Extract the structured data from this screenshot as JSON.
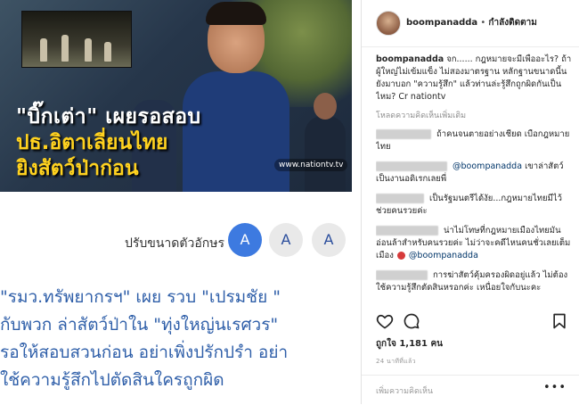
{
  "article": {
    "image": {
      "headline_line1": "\"บิ๊กเต่า\" เผยรอสอบ",
      "headline_line2": "ปธ.อิตาเลี่ยนไทย",
      "headline_line3": "ยิงสัตว์ป่าก่อน",
      "logo_text": "www.nationtv.tv"
    },
    "font_size": {
      "label": "ปรับขนาดตัวอักษร",
      "options": [
        "A",
        "A",
        "A"
      ],
      "selected_index": 0
    },
    "body_lines": [
      "\"รมว.ทรัพยากรฯ\" เผย รวบ \"เปรมชัย \"",
      "กับพวก ล่าสัตว์ป่าใน \"ทุ่งใหญ่นเรศวร\"",
      "รอให้สอบสวนก่อน อย่าเพิ่งปรักปรำ อย่า",
      "ใช้ความรู้สึกไปตัดสินใครถูกผิด"
    ]
  },
  "instagram": {
    "username": "boompanadda",
    "dot": " • ",
    "follow_status": "กำลังติดตาม",
    "caption": {
      "user": "boompanadda",
      "text": "จก...... กฎหมายจะมีเพื่ออะไร? ถ้าผู้ใหญ่ไม่เข้มแข็ง ไม่สองมาตรฐาน หลักฐานขนาดนี้น ยังมาบอก \"ความรู้สึก\" แล้วท่านล่ะรู้สึกถูกผิดกันเป็นไหม? Cr nationtv"
    },
    "load_more": "โหลดความคิดเห็นเพิ่มเติม",
    "comments": [
      {
        "text": "ถ้าคนจนตายอย่างเชียด เบือกฎหมายไทย",
        "mention": ""
      },
      {
        "text": "เขาล่าสัตว์เป็นงานอดิเรกเลยพี่",
        "mention": "@boompanadda"
      },
      {
        "text": "เป็นรัฐมนตรีได้งัย...กฎหมายไทยมีไว้ช่วยคนรวยค่ะ",
        "mention": ""
      },
      {
        "text": "น่าไม่โทษที่กฎหมายเมืองไทยมันอ่อนล้าสำหรับคนรวยค่ะ ไม่ว่าจะคดีไหนคนชั่วเลยเต็มเมือง",
        "mention": "@boompanadda"
      },
      {
        "text": "การฆ่าสัตว์คุ้มครองผิดอยู่แล้ว ไม่ต้องใช้ความรู้สึกตัดสินหรอกค่ะ เหนื่อยใจกับนะคะ",
        "mention": ""
      }
    ],
    "likes": "ถูกใจ 1,181 คน",
    "time": "24 นาทีที่แล้ว",
    "add_comment_placeholder": "เพิ่มความคิดเห็น",
    "more_options": "•••",
    "icons": [
      "heart-icon",
      "comment-icon",
      "bookmark-icon"
    ]
  }
}
